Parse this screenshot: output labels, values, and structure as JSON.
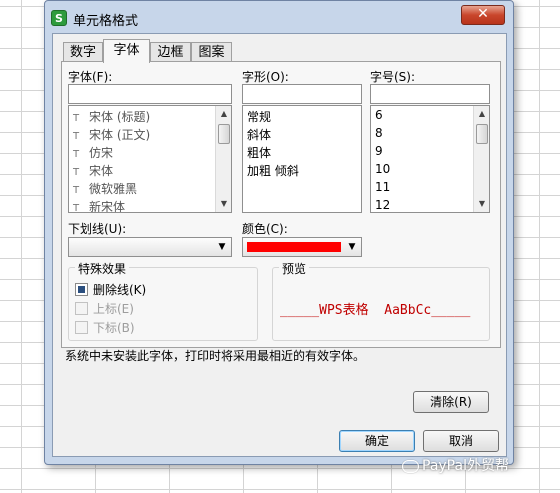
{
  "dialog": {
    "title": "单元格格式",
    "app_icon_letter": "S",
    "close_symbol": "✕"
  },
  "tabs": [
    {
      "label": "数字",
      "active": false
    },
    {
      "label": "字体",
      "active": true
    },
    {
      "label": "边框",
      "active": false
    },
    {
      "label": "图案",
      "active": false
    }
  ],
  "font": {
    "label": "字体(F):",
    "value": "",
    "items": [
      "宋体 (标题)",
      "宋体 (正文)",
      "仿宋",
      "宋体",
      "微软雅黑",
      "新宋体"
    ],
    "item_icon": "font-type-icon"
  },
  "style": {
    "label": "字形(O):",
    "value": "",
    "items": [
      "常规",
      "斜体",
      "粗体",
      "加粗 倾斜"
    ]
  },
  "size": {
    "label": "字号(S):",
    "value": "",
    "items": [
      "6",
      "8",
      "9",
      "10",
      "11",
      "12"
    ]
  },
  "underline": {
    "label": "下划线(U):",
    "value": ""
  },
  "color": {
    "label": "颜色(C):",
    "value": "#ff0000"
  },
  "effects": {
    "title": "特殊效果",
    "items": [
      {
        "label": "删除线(K)",
        "checked": true,
        "enabled": true
      },
      {
        "label": "上标(E)",
        "checked": false,
        "enabled": false
      },
      {
        "label": "下标(B)",
        "checked": false,
        "enabled": false
      }
    ]
  },
  "preview": {
    "title": "预览",
    "text": "_____WPS表格  AaBbCc_____",
    "color": "#c00000"
  },
  "note": "系统中未安装此字体，打印时将采用最相近的有效字体。",
  "buttons": {
    "clear": "清除(R)",
    "ok": "确定",
    "cancel": "取消"
  },
  "watermark": "PayPal外贸帮"
}
